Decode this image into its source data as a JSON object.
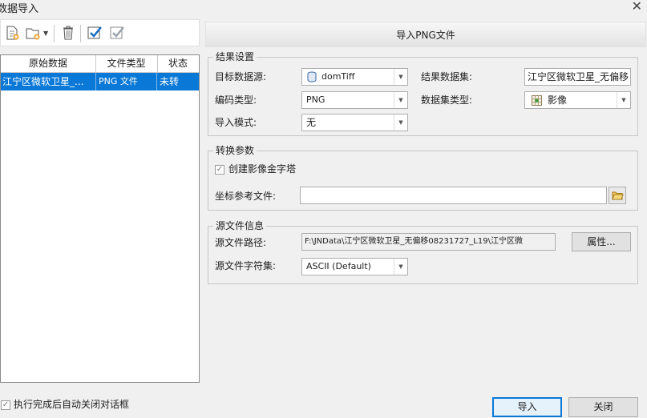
{
  "window": {
    "title": "数据导入",
    "close_glyph": "✕"
  },
  "toolbar": {
    "icons": [
      "add-file-icon",
      "add-folder-icon",
      "delete-icon",
      "select-all-icon",
      "invert-select-icon"
    ]
  },
  "file_list": {
    "headers": [
      "原始数据",
      "文件类型",
      "状态"
    ],
    "rows": [
      {
        "source": "江宁区微软卫星_...",
        "type": "PNG 文件",
        "status": "未转"
      }
    ]
  },
  "panel_title": "导入PNG文件",
  "result_settings": {
    "legend": "结果设置",
    "target_datasource_label": "目标数据源:",
    "target_datasource_value": "domTiff",
    "result_dataset_label": "结果数据集:",
    "result_dataset_value": "江宁区微软卫星_无偏移",
    "encoding_label": "编码类型:",
    "encoding_value": "PNG",
    "dataset_type_label": "数据集类型:",
    "dataset_type_value": "影像",
    "import_mode_label": "导入模式:",
    "import_mode_value": "无"
  },
  "conversion": {
    "legend": "转换参数",
    "pyramid_label": "创建影像金字塔",
    "pyramid_checked": true,
    "coord_ref_label": "坐标参考文件:",
    "coord_ref_value": ""
  },
  "source_info": {
    "legend": "源文件信息",
    "path_label": "源文件路径:",
    "path_value": "F:\\JNData\\江宁区微软卫星_无偏移08231727_L19\\江宁区微",
    "properties_button": "属性...",
    "charset_label": "源文件字符集:",
    "charset_value": "ASCII (Default)"
  },
  "footer": {
    "auto_close_label": "执行完成后自动关闭对话框",
    "auto_close_checked": true,
    "import_button": "导入",
    "close_button": "关闭"
  },
  "colors": {
    "selection": "#0a78d7",
    "accent_check": "#1a6cc7"
  }
}
